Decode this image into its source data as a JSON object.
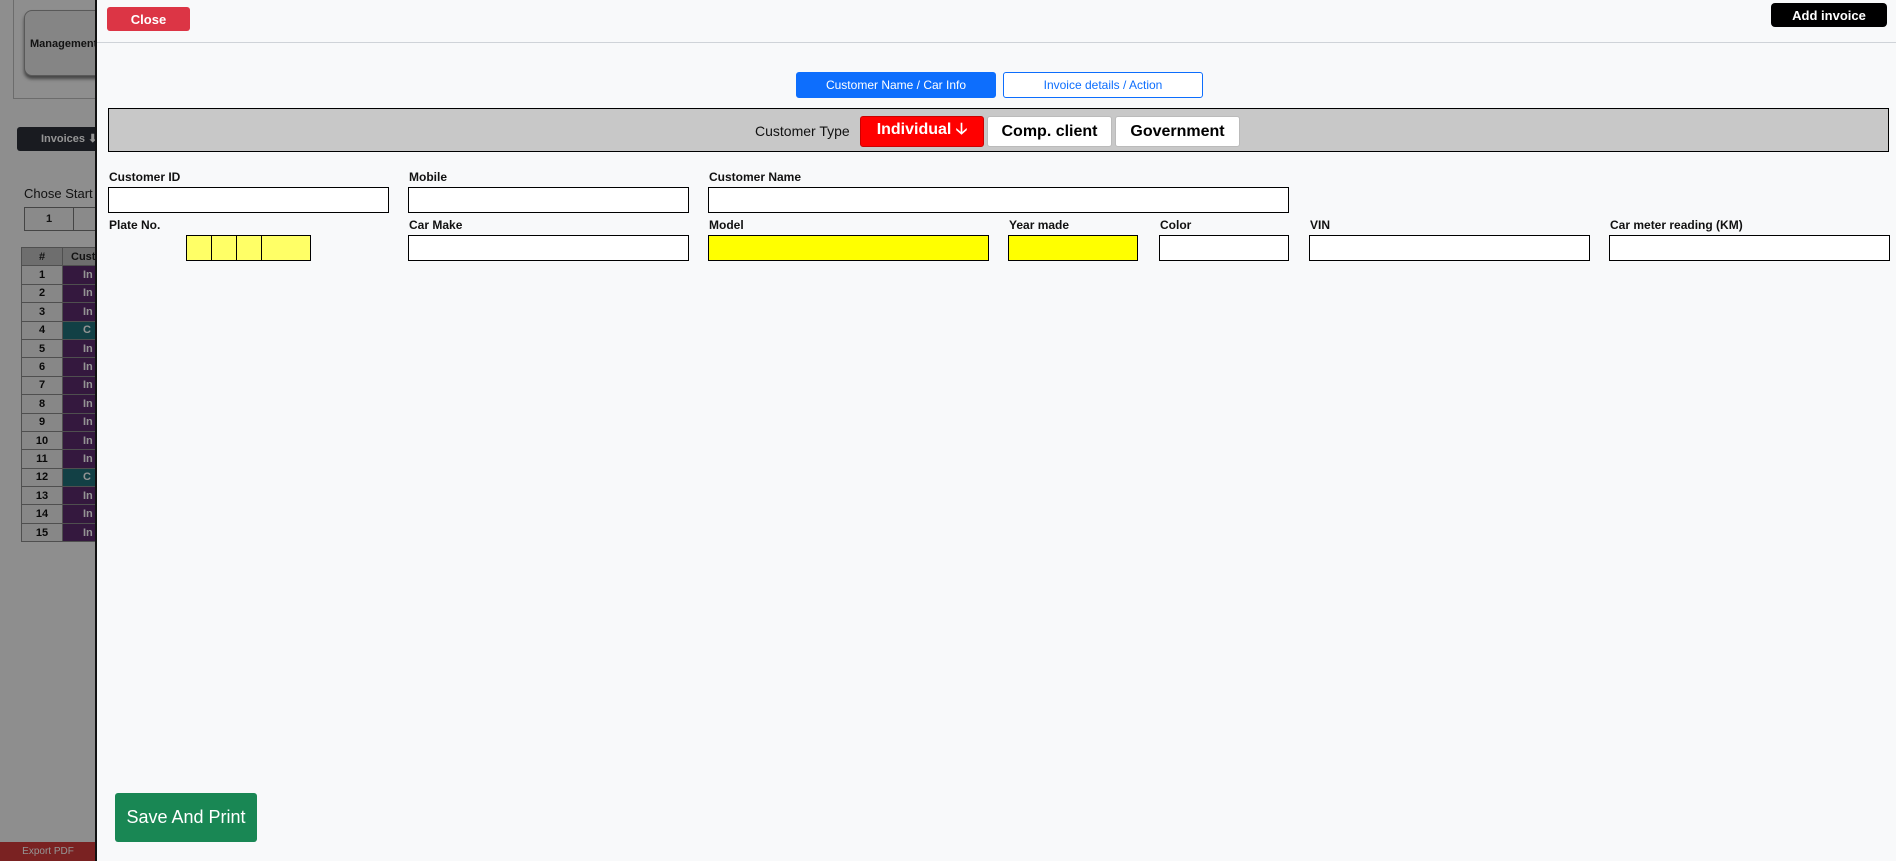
{
  "background": {
    "management_label": "Management",
    "invoices_label": "Invoices ⬇",
    "chose_start_text": "Chose Start d",
    "pager_page": "1",
    "table": {
      "headers": [
        "#",
        "Cust"
      ],
      "rows": [
        {
          "num": "1",
          "type": "In",
          "color": "purple"
        },
        {
          "num": "2",
          "type": "In",
          "color": "purple"
        },
        {
          "num": "3",
          "type": "In",
          "color": "purple"
        },
        {
          "num": "4",
          "type": "C",
          "color": "teal"
        },
        {
          "num": "5",
          "type": "In",
          "color": "purple"
        },
        {
          "num": "6",
          "type": "In",
          "color": "purple"
        },
        {
          "num": "7",
          "type": "In",
          "color": "purple"
        },
        {
          "num": "8",
          "type": "In",
          "color": "purple"
        },
        {
          "num": "9",
          "type": "In",
          "color": "purple"
        },
        {
          "num": "10",
          "type": "In",
          "color": "purple"
        },
        {
          "num": "11",
          "type": "In",
          "color": "purple"
        },
        {
          "num": "12",
          "type": "C",
          "color": "teal"
        },
        {
          "num": "13",
          "type": "In",
          "color": "purple"
        },
        {
          "num": "14",
          "type": "In",
          "color": "purple"
        },
        {
          "num": "15",
          "type": "In",
          "color": "purple"
        }
      ]
    },
    "export_label": "Export PDF"
  },
  "header": {
    "close_label": "Close",
    "add_invoice_label": "Add invoice"
  },
  "tabs": [
    {
      "label": "Customer Name / Car Info",
      "active": true
    },
    {
      "label": "Invoice details / Action",
      "active": false
    }
  ],
  "customer_type": {
    "label": "Customer Type",
    "options": [
      {
        "label": "Individual 🡣",
        "selected": true
      },
      {
        "label": "Comp. client",
        "selected": false
      },
      {
        "label": "Government",
        "selected": false
      }
    ]
  },
  "fields": {
    "customer_id": {
      "label": "Customer ID",
      "value": ""
    },
    "mobile": {
      "label": "Mobile",
      "value": ""
    },
    "customer_name": {
      "label": "Customer Name",
      "value": ""
    },
    "plate_no": {
      "label": "Plate No.",
      "boxes": [
        "",
        "",
        "",
        ""
      ]
    },
    "car_make": {
      "label": "Car Make",
      "value": ""
    },
    "model": {
      "label": "Model",
      "value": ""
    },
    "year_made": {
      "label": "Year made",
      "value": ""
    },
    "color": {
      "label": "Color",
      "value": ""
    },
    "vin": {
      "label": "VIN",
      "value": ""
    },
    "meter": {
      "label": "Car meter reading (KM)",
      "value": ""
    }
  },
  "save_label": "Save And Print",
  "colors": {
    "close": "#dc3545",
    "add_invoice": "#000000",
    "tab_active": "#0d6efd",
    "individual_selected": "#ff0000",
    "required_field": "#ffff00",
    "save": "#198754"
  }
}
